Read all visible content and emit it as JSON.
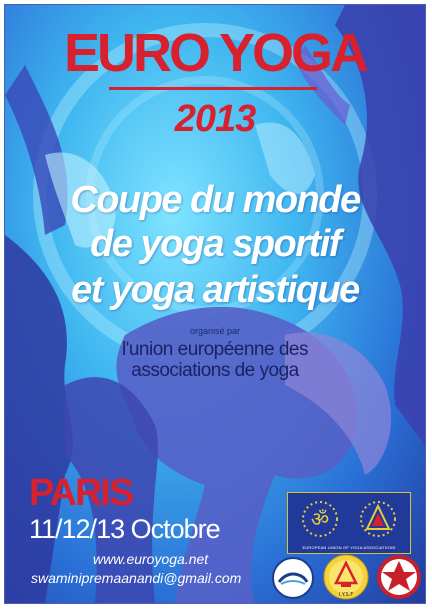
{
  "poster": {
    "title": "EURO YOGA",
    "year": "2013",
    "headline": {
      "line1": "Coupe du monde",
      "line2": "de yoga sportif",
      "line3_pre": "et yoga ",
      "line3_accent": "artistique"
    },
    "organised_by": "organisé par",
    "organisation": {
      "line1": "l'union européenne des",
      "line2": "associations de yoga"
    },
    "city": "PARIS",
    "dates": "11/12/13 Octobre",
    "website": "www.euroyoga.net",
    "email": "swaminipremaanandi@gmail.com"
  },
  "logos": {
    "union_caption": "EUROPEAN UNION OF YOGA ASSOCIATIONS",
    "iysf_caption": "I.Y.S.F",
    "items": [
      "om-logo",
      "pyramid-logo",
      "european-federation-seal",
      "iysf-seal",
      "star-seal"
    ]
  },
  "colors": {
    "title_red": "#d8212e",
    "background_blue": "#2a6fd6",
    "cyan": "#7fe4ff",
    "flag_blue": "#213a9a",
    "gold": "#d6c23a"
  }
}
